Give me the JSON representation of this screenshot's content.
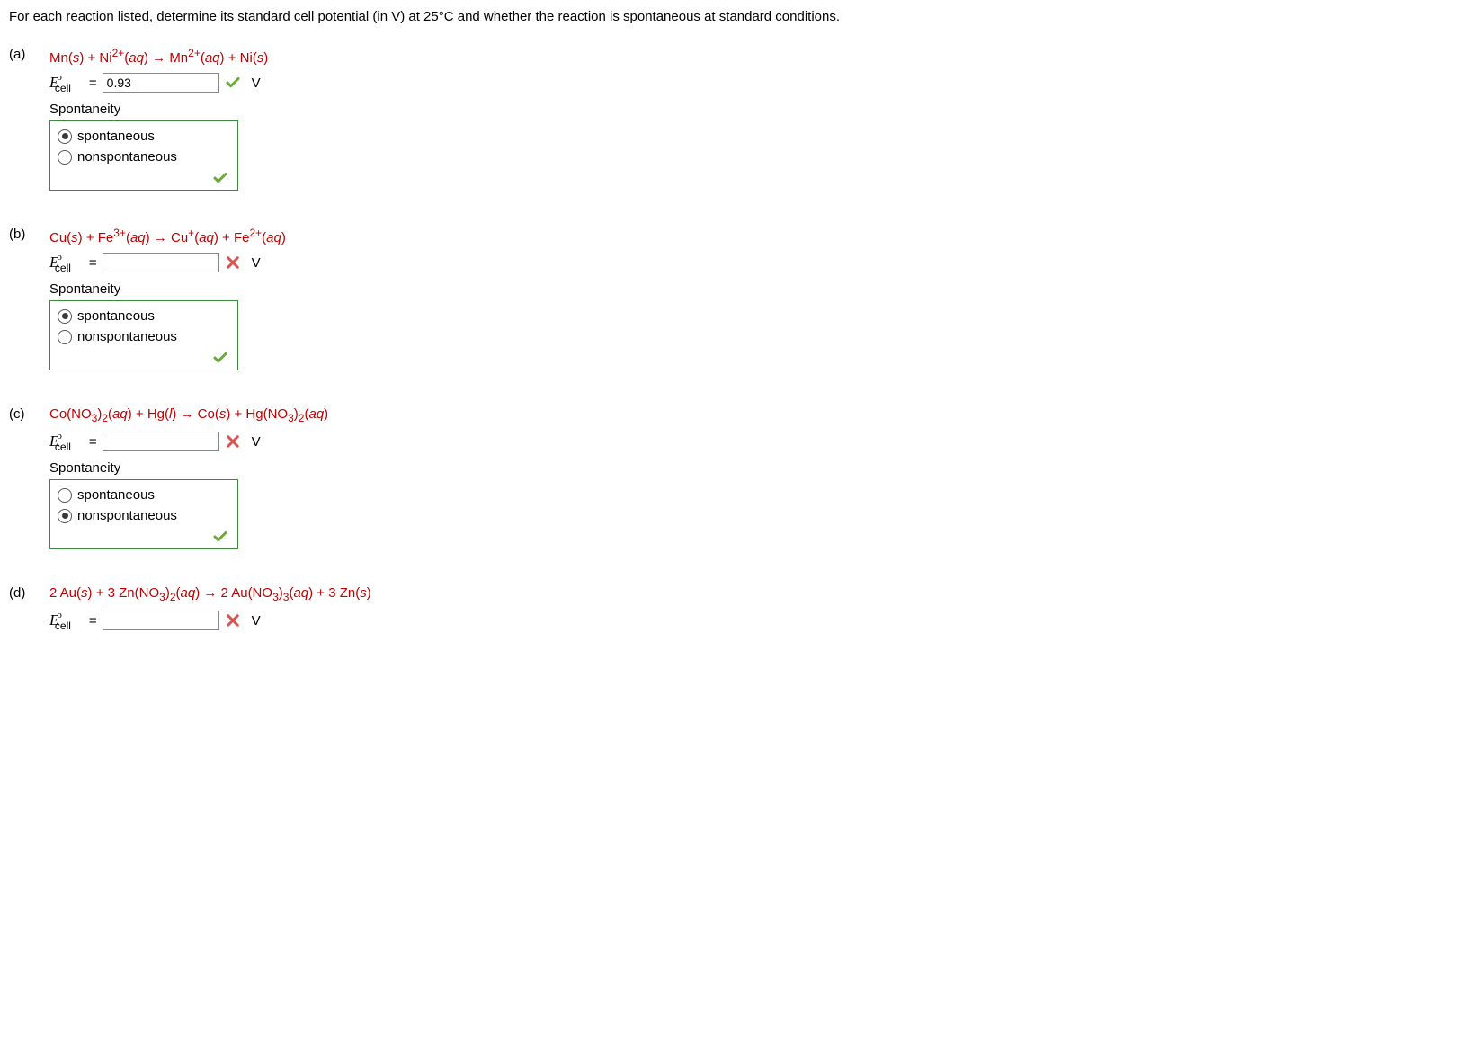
{
  "intro": "For each reaction listed, determine its standard cell potential (in V) at 25°C and whether the reaction is spontaneous at standard conditions.",
  "ecell_label": "E",
  "ecell_sup": "o",
  "ecell_sub": "cell",
  "equals": "=",
  "unit": "V",
  "spontaneity_label": "Spontaneity",
  "option_spont": "spontaneous",
  "option_nonspont": "nonspontaneous",
  "parts": {
    "a": {
      "label": "(a)",
      "input_value": "0.93",
      "input_feedback": "correct",
      "selected": "spontaneous",
      "box_feedback": "correct"
    },
    "b": {
      "label": "(b)",
      "input_value": "",
      "input_feedback": "incorrect",
      "selected": "spontaneous",
      "box_feedback": "correct"
    },
    "c": {
      "label": "(c)",
      "input_value": "",
      "input_feedback": "incorrect",
      "selected": "nonspontaneous",
      "box_feedback": "correct"
    },
    "d": {
      "label": "(d)",
      "input_value": "",
      "input_feedback": "incorrect"
    }
  }
}
